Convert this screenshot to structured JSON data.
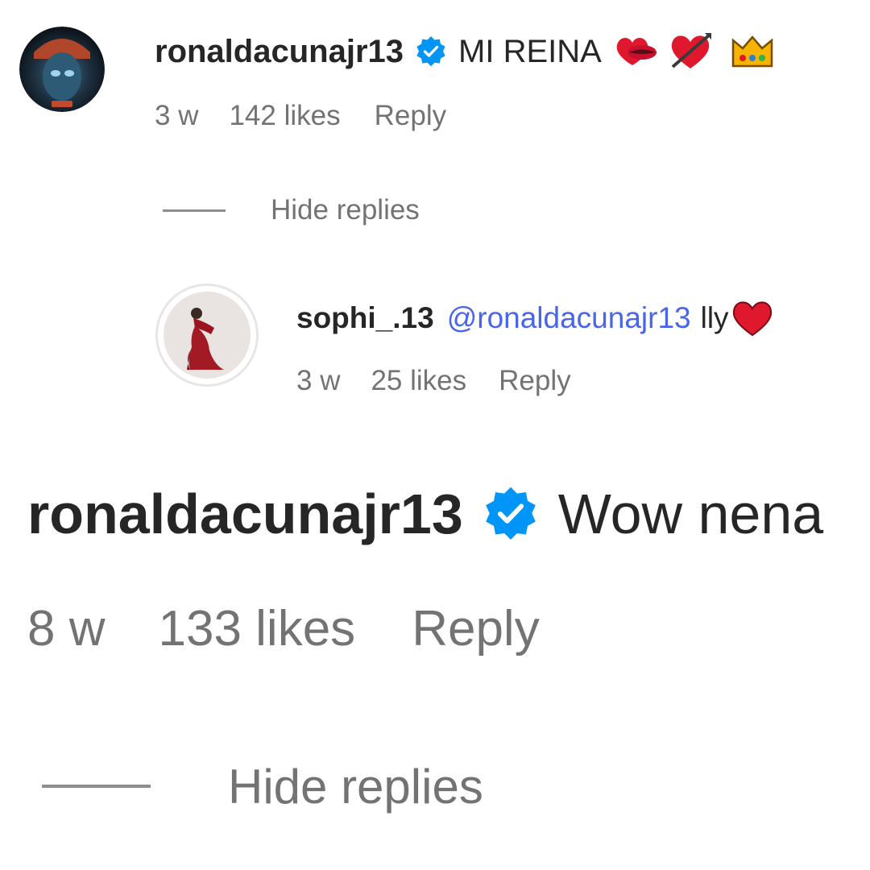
{
  "comments": [
    {
      "username": "ronaldacunajr13",
      "verified": true,
      "text": "MI REINA",
      "emojis": [
        "lips-heart-emoji",
        "heart-arrow-emoji",
        "crown-emoji"
      ],
      "time": "3 w",
      "likes": "142 likes",
      "reply_label": "Reply",
      "hide_replies_label": "Hide replies",
      "replies": [
        {
          "username": "sophi_.13",
          "mention": "@ronaldacunajr13",
          "text": "lly",
          "emojis": [
            "red-heart-emoji"
          ],
          "time": "3 w",
          "likes": "25 likes",
          "reply_label": "Reply"
        }
      ]
    },
    {
      "username": "ronaldacunajr13",
      "verified": true,
      "text": "Wow nena",
      "time": "8 w",
      "likes": "133 likes",
      "reply_label": "Reply",
      "hide_replies_label": "Hide replies"
    }
  ],
  "colors": {
    "verified_blue": "#0095f6",
    "mention_blue": "#4a66e8",
    "muted_gray": "#737373",
    "heart_red": "#e0182d"
  }
}
